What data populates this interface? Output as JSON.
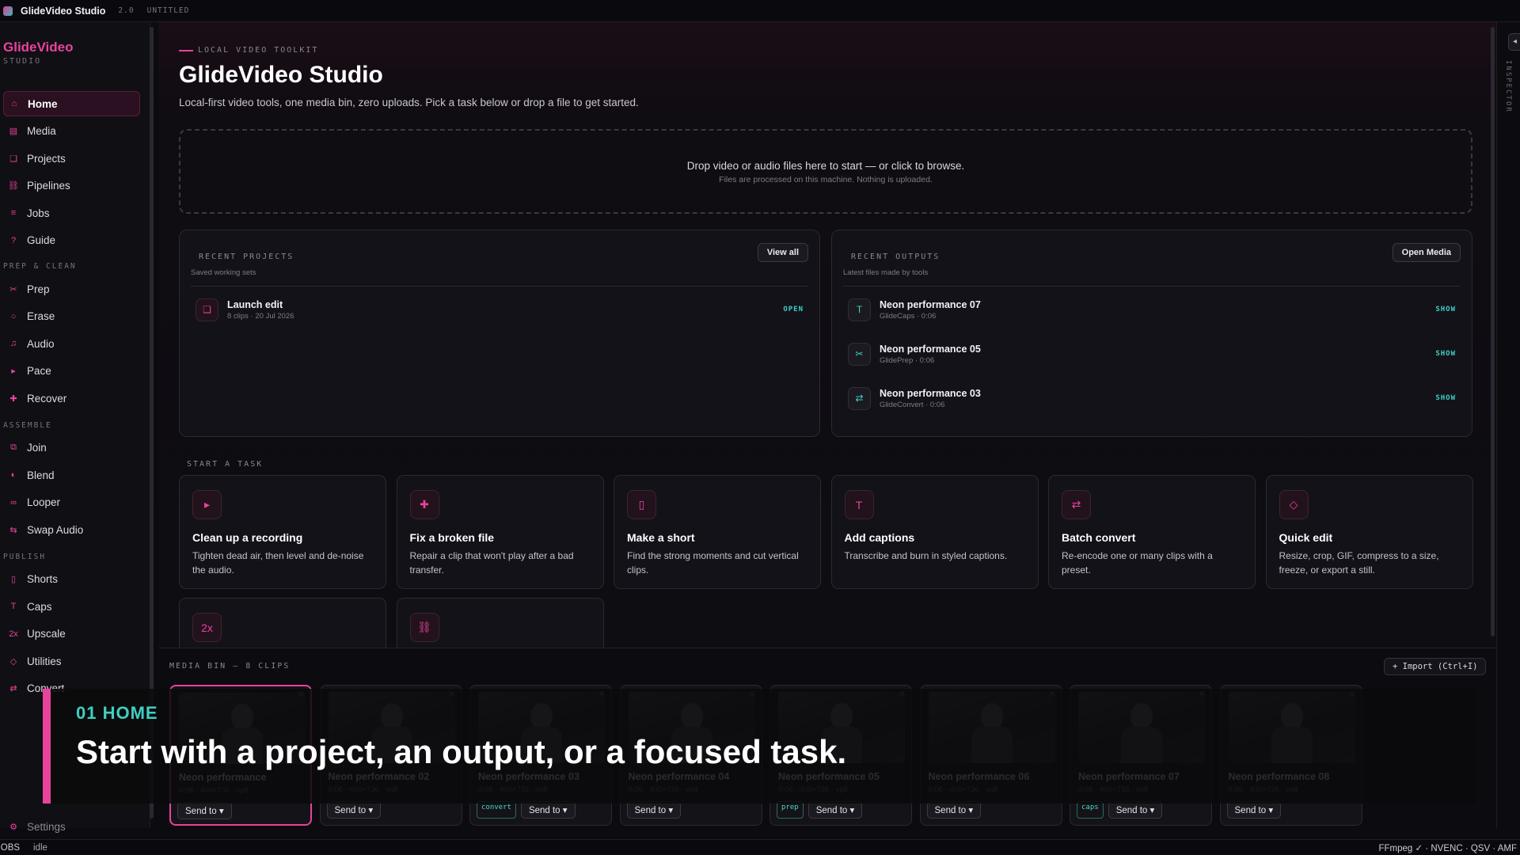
{
  "titlebar": {
    "app_name": "GlideVideo Studio",
    "version": "2.0",
    "doc": "UNTITLED"
  },
  "brand": {
    "name": "GlideVideo",
    "sub": "STUDIO"
  },
  "sidebar": {
    "items": [
      {
        "label": "Home",
        "icon": "home-icon",
        "glyph": "⌂"
      },
      {
        "label": "Media",
        "icon": "media-icon",
        "glyph": "▤"
      },
      {
        "label": "Projects",
        "icon": "projects-icon",
        "glyph": "❏"
      },
      {
        "label": "Pipelines",
        "icon": "pipelines-icon",
        "glyph": "⛓"
      },
      {
        "label": "Jobs",
        "icon": "jobs-icon",
        "glyph": "≡"
      },
      {
        "label": "Guide",
        "icon": "guide-icon",
        "glyph": "?"
      }
    ],
    "sections": [
      {
        "title": "PREP & CLEAN",
        "items": [
          {
            "label": "Prep",
            "icon": "scissors-icon",
            "glyph": "✂"
          },
          {
            "label": "Erase",
            "icon": "erase-icon",
            "glyph": "○"
          },
          {
            "label": "Audio",
            "icon": "music-icon",
            "glyph": "♫"
          },
          {
            "label": "Pace",
            "icon": "pace-icon",
            "glyph": "▸"
          },
          {
            "label": "Recover",
            "icon": "plus-icon",
            "glyph": "✚"
          }
        ]
      },
      {
        "title": "ASSEMBLE",
        "items": [
          {
            "label": "Join",
            "icon": "join-icon",
            "glyph": "⧉"
          },
          {
            "label": "Blend",
            "icon": "blend-icon",
            "glyph": "◐"
          },
          {
            "label": "Looper",
            "icon": "loop-icon",
            "glyph": "∞"
          },
          {
            "label": "Swap Audio",
            "icon": "swap-icon",
            "glyph": "⇆"
          }
        ]
      },
      {
        "title": "PUBLISH",
        "items": [
          {
            "label": "Shorts",
            "icon": "shorts-icon",
            "glyph": "▯"
          },
          {
            "label": "Caps",
            "icon": "caps-icon",
            "glyph": "T"
          },
          {
            "label": "Upscale",
            "icon": "upscale-icon",
            "glyph": "2x"
          },
          {
            "label": "Utilities",
            "icon": "utilities-icon",
            "glyph": "◇"
          },
          {
            "label": "Convert",
            "icon": "convert-icon",
            "glyph": "⇄"
          }
        ]
      }
    ],
    "settings": "Settings"
  },
  "home": {
    "kicker": "LOCAL VIDEO TOOLKIT",
    "title": "GlideVideo Studio",
    "subtitle": "Local-first video tools, one media bin, zero uploads. Pick a task below or drop a file to get started.",
    "drop_primary": "Drop video or audio files here to start — or click to browse.",
    "drop_secondary": "Files are processed on this machine. Nothing is uploaded."
  },
  "recent_projects": {
    "title": "RECENT PROJECTS",
    "subtitle": "Saved working sets",
    "button": "View all",
    "items": [
      {
        "name": "Launch edit",
        "meta": "8 clips · 20 Jul 2026",
        "action": "OPEN"
      }
    ]
  },
  "recent_outputs": {
    "title": "RECENT OUTPUTS",
    "subtitle": "Latest files made by tools",
    "button": "Open Media",
    "items": [
      {
        "name": "Neon performance 07",
        "meta": "GlideCaps · 0:06",
        "action": "SHOW",
        "glyph": "T"
      },
      {
        "name": "Neon performance 05",
        "meta": "GlidePrep · 0:06",
        "action": "SHOW",
        "glyph": "✂"
      },
      {
        "name": "Neon performance 03",
        "meta": "GlideConvert · 0:06",
        "action": "SHOW",
        "glyph": "⇄"
      }
    ]
  },
  "tasks": {
    "title": "START A TASK",
    "items": [
      {
        "title": "Clean up a recording",
        "desc": "Tighten dead air, then level and de-noise the audio.",
        "icon": "play-icon",
        "glyph": "▸"
      },
      {
        "title": "Fix a broken file",
        "desc": "Repair a clip that won't play after a bad transfer.",
        "icon": "plus-icon",
        "glyph": "✚"
      },
      {
        "title": "Make a short",
        "desc": "Find the strong moments and cut vertical clips.",
        "icon": "phone-icon",
        "glyph": "▯"
      },
      {
        "title": "Add captions",
        "desc": "Transcribe and burn in styled captions.",
        "icon": "text-icon",
        "glyph": "T"
      },
      {
        "title": "Batch convert",
        "desc": "Re-encode one or many clips with a preset.",
        "icon": "convert-icon",
        "glyph": "⇄"
      },
      {
        "title": "Quick edit",
        "desc": "Resize, crop, GIF, compress to a size, freeze, or export a still.",
        "icon": "diamond-icon",
        "glyph": "◇"
      },
      {
        "title": "",
        "desc": "",
        "icon": "upscale-icon",
        "glyph": "2x"
      },
      {
        "title": "",
        "desc": "",
        "icon": "pipeline-icon",
        "glyph": "⛓"
      }
    ]
  },
  "media_bin": {
    "title": "MEDIA BIN — 8 CLIPS",
    "import": "+ Import (Ctrl+I)",
    "clips": [
      {
        "name": "Neon performance",
        "meta": "0:06 · 400×736 · vp8",
        "tag": "",
        "send": "Send to ▾"
      },
      {
        "name": "Neon performance 02",
        "meta": "0:06 · 400×736 · vp8",
        "tag": "",
        "send": "Send to ▾"
      },
      {
        "name": "Neon performance 03",
        "meta": "0:06 · 400×736 · vp8",
        "tag": "convert",
        "send": "Send to ▾"
      },
      {
        "name": "Neon performance 04",
        "meta": "0:06 · 400×736 · vp8",
        "tag": "",
        "send": "Send to ▾"
      },
      {
        "name": "Neon performance 05",
        "meta": "0:06 · 400×736 · vp8",
        "tag": "prep",
        "send": "Send to ▾"
      },
      {
        "name": "Neon performance 06",
        "meta": "0:06 · 400×736 · vp8",
        "tag": "",
        "send": "Send to ▾"
      },
      {
        "name": "Neon performance 07",
        "meta": "0:06 · 400×736 · vp8",
        "tag": "caps",
        "send": "Send to ▾"
      },
      {
        "name": "Neon performance 08",
        "meta": "0:06 · 400×736 · vp8",
        "tag": "",
        "send": "Send to ▾"
      }
    ]
  },
  "caption": {
    "number": "01  HOME",
    "text": "Start with a project, an output, or a focused task."
  },
  "inspector": {
    "label": "INSPECTOR",
    "toggle": "◂"
  },
  "statusbar": {
    "jobs": "JOBS",
    "status": "idle",
    "caps": "FFmpeg ✓ · NVENC · QSV · AMF"
  },
  "colors": {
    "accent": "#e8439c",
    "teal": "#3ed0c4",
    "bg": "#0c0b10"
  }
}
